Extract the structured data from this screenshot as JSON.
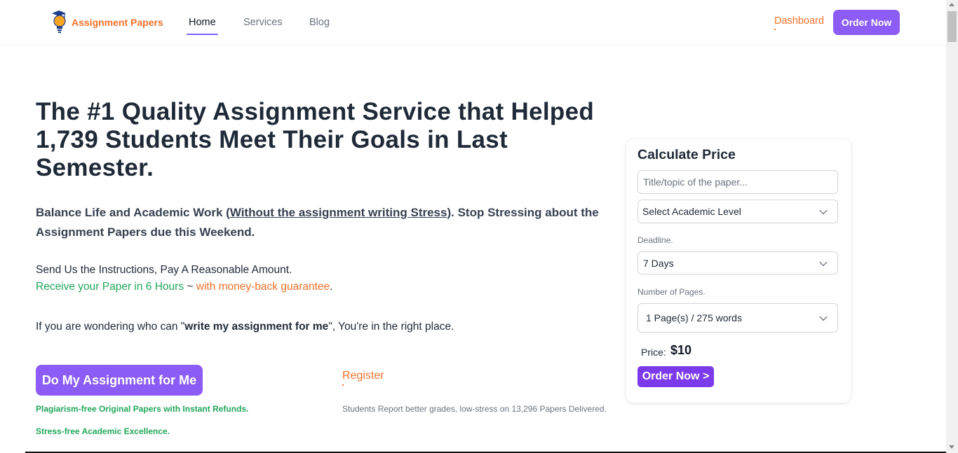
{
  "header": {
    "brand": "Assignment Papers",
    "nav": {
      "home": "Home",
      "services": "Services",
      "blog": "Blog"
    },
    "dashboard": "Dashboard",
    "order_now": "Order Now"
  },
  "hero": {
    "title": "The #1 Quality Assignment Service that Helped 1,739 Students Meet Their Goals in Last Semester.",
    "sub_part1": "Balance Life and Academic Work (",
    "sub_link": "Without the assignment writing Stress",
    "sub_part2": "). Stop Stressing about the Assignment Papers due this Weekend.",
    "send_line": "Send Us the Instructions, Pay A Reasonable Amount.",
    "receive": "Receive your Paper in 6 Hours",
    "tilde": " ~ ",
    "guarantee": "with money-back guarantee",
    "period": ".",
    "wonder_part1": "If you are wondering who can \"",
    "wonder_bold": "write my assignment for me",
    "wonder_part2": "\", You're in the right place.",
    "cta": "Do My Assignment for Me",
    "note1": "Plagiarism-free Original Papers with Instant Refunds.",
    "note2": "Stress-free Academic Excellence.",
    "register": "Register",
    "report": "Students Report better grades, low-stress on 13,296 Papers Delivered."
  },
  "calculator": {
    "title": "Calculate Price",
    "topic_placeholder": "Title/topic of the paper...",
    "level": "Select Academic Level",
    "deadline_label": "Deadline.",
    "deadline": "7 Days",
    "pages_label": "Number of Pages.",
    "pages": "1 Page(s) / 275 words",
    "price_label": "Price:",
    "price": "$10",
    "order": "Order Now >"
  },
  "colors": {
    "accent": "#8b5cf6",
    "brand_orange": "#f0712a",
    "green": "#22a75a"
  }
}
